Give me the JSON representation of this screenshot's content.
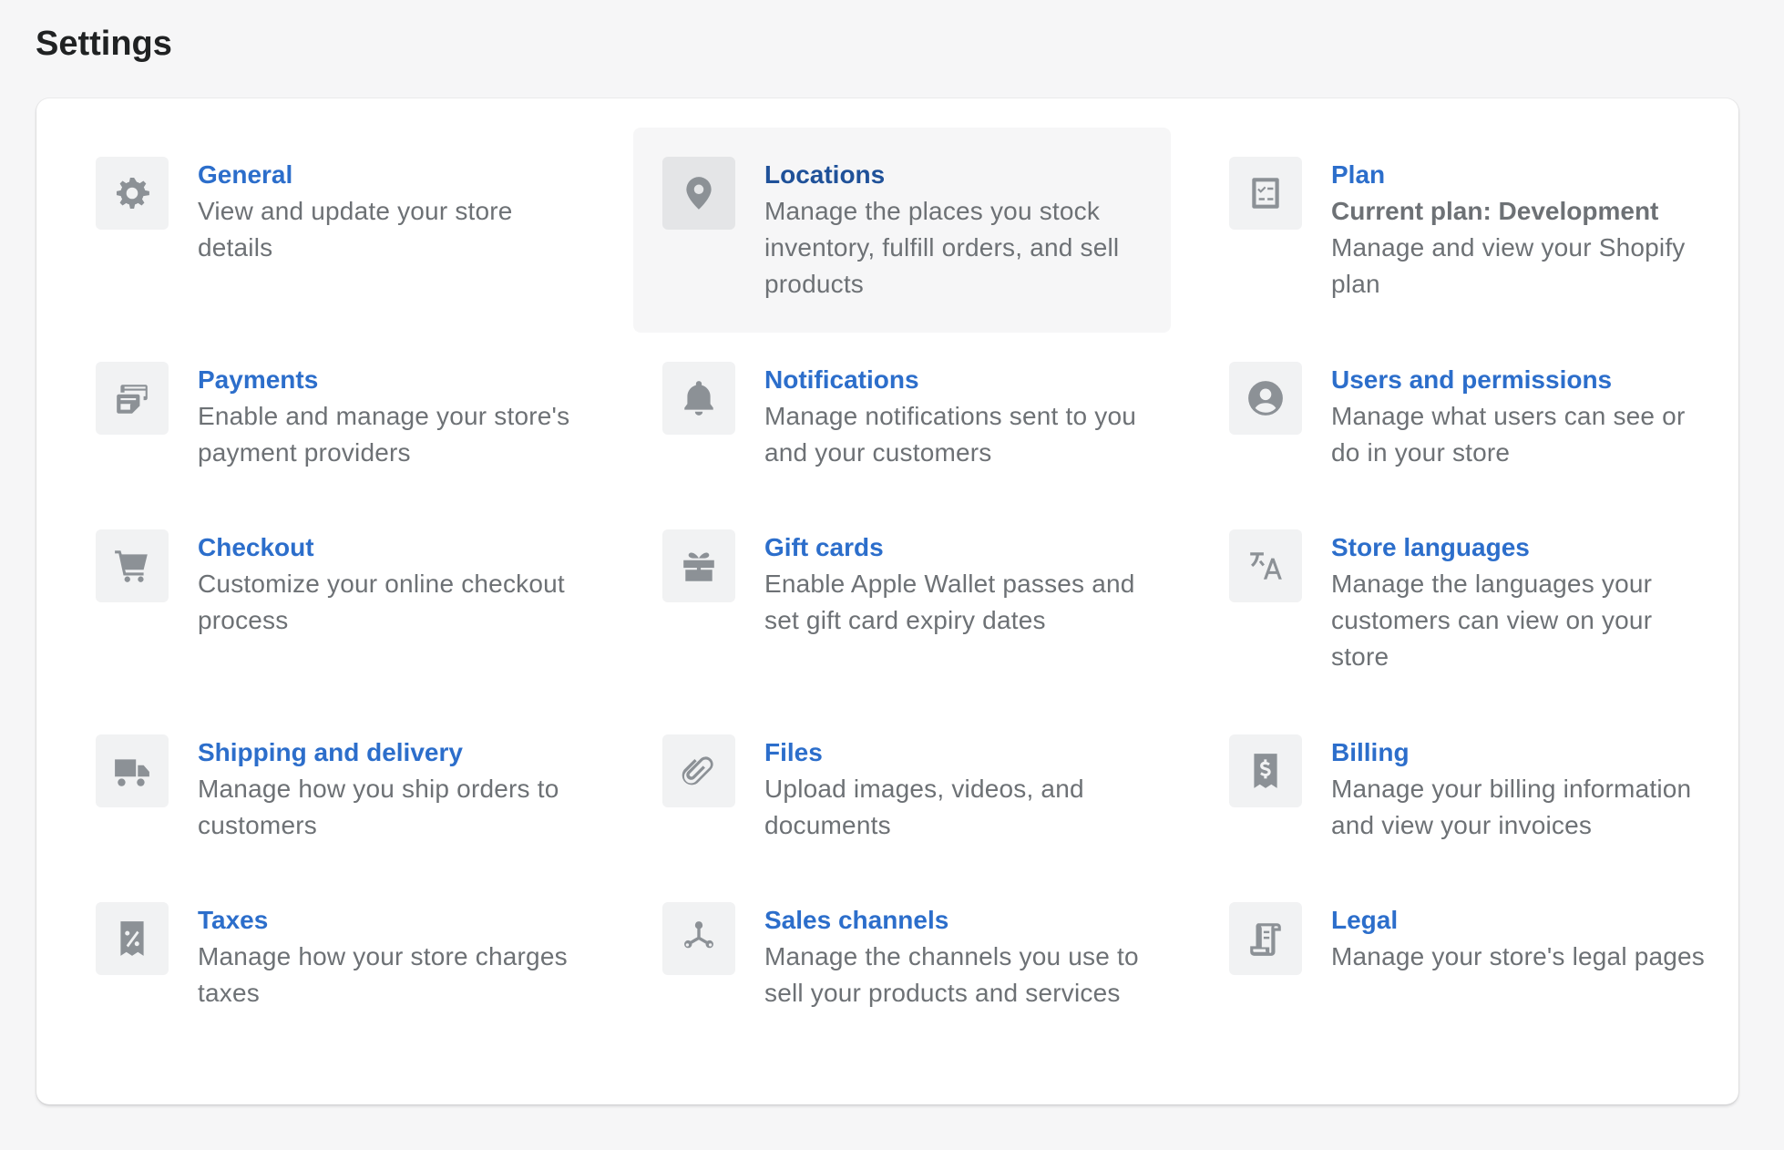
{
  "page": {
    "title": "Settings"
  },
  "settings": [
    {
      "title": "General",
      "description": "View and update your store details",
      "icon": "gear-icon"
    },
    {
      "title": "Locations",
      "description": "Manage the places you stock inventory, fulfill orders, and sell products",
      "icon": "location-pin-icon"
    },
    {
      "title": "Plan",
      "subtitle": "Current plan: Development",
      "description": "Manage and view your Shopify plan",
      "icon": "checklist-icon"
    },
    {
      "title": "Payments",
      "description": "Enable and manage your store's payment providers",
      "icon": "payment-cards-icon"
    },
    {
      "title": "Notifications",
      "description": "Manage notifications sent to you and your customers",
      "icon": "bell-icon"
    },
    {
      "title": "Users and permissions",
      "description": "Manage what users can see or do in your store",
      "icon": "user-circle-icon"
    },
    {
      "title": "Checkout",
      "description": "Customize your online checkout process",
      "icon": "cart-icon"
    },
    {
      "title": "Gift cards",
      "description": "Enable Apple Wallet passes and set gift card expiry dates",
      "icon": "gift-icon"
    },
    {
      "title": "Store languages",
      "description": "Manage the languages your customers can view on your store",
      "icon": "translate-icon"
    },
    {
      "title": "Shipping and delivery",
      "description": "Manage how you ship orders to customers",
      "icon": "truck-icon"
    },
    {
      "title": "Files",
      "description": "Upload images, videos, and documents",
      "icon": "paperclip-icon"
    },
    {
      "title": "Billing",
      "description": "Manage your billing information and view your invoices",
      "icon": "dollar-receipt-icon"
    },
    {
      "title": "Taxes",
      "description": "Manage how your store charges taxes",
      "icon": "tax-receipt-icon"
    },
    {
      "title": "Sales channels",
      "description": "Manage the channels you use to sell your products and services",
      "icon": "channels-icon"
    },
    {
      "title": "Legal",
      "description": "Manage your store's legal pages",
      "icon": "scroll-icon"
    }
  ]
}
